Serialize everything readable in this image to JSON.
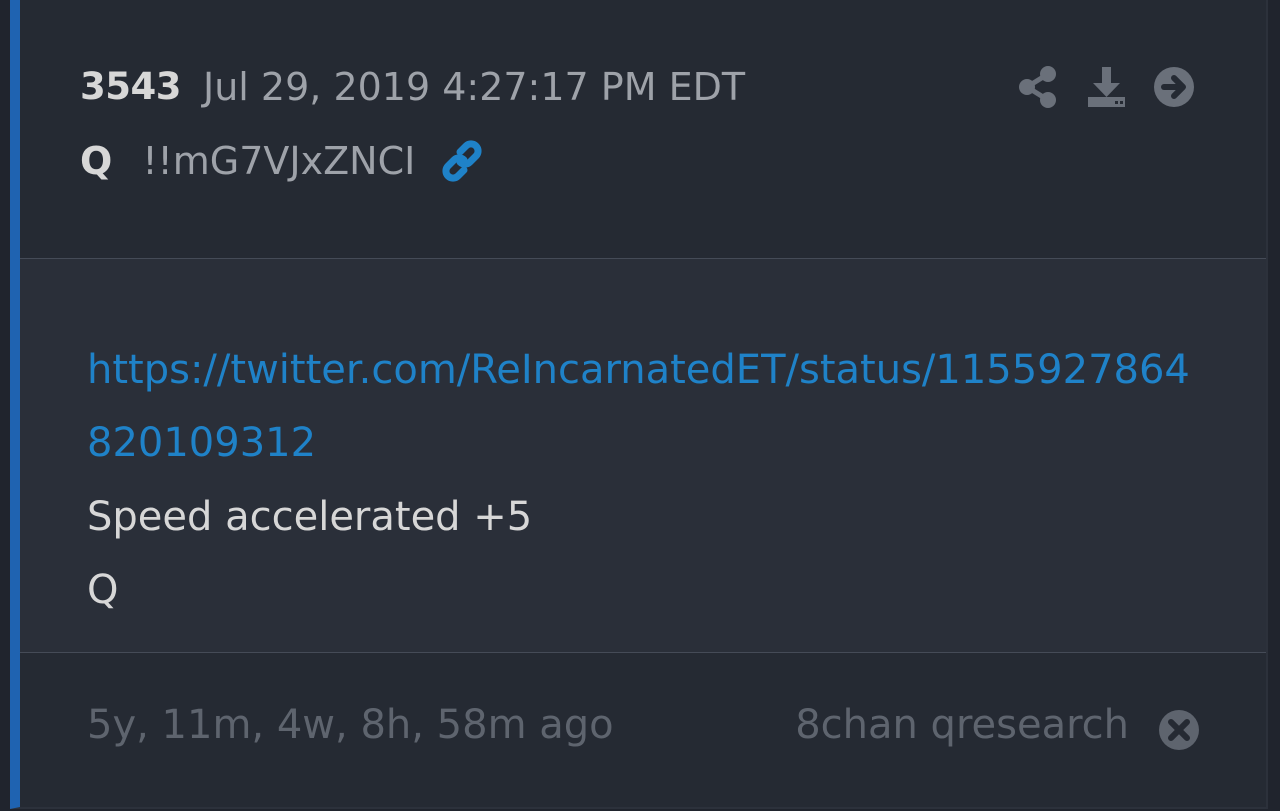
{
  "post": {
    "number": "3543",
    "timestamp": "Jul 29, 2019 4:27:17 PM EDT",
    "author": "Q",
    "tripcode": "!!mG7VJxZNCI",
    "link_url": "https://twitter.com/ReIncarnatedET/status/1155927864820109312",
    "lines": [
      "Speed accelerated +5",
      "Q"
    ]
  },
  "footer": {
    "age": "5y, 11m, 4w, 8h, 58m ago",
    "source": "8chan qresearch"
  },
  "icons": {
    "link": "link-icon",
    "share": "share-icon",
    "download": "download-icon",
    "next": "arrow-right-circle-icon",
    "close": "close-circle-icon"
  },
  "colors": {
    "accent_bar": "#1f63b1",
    "link": "#1f82c8"
  }
}
